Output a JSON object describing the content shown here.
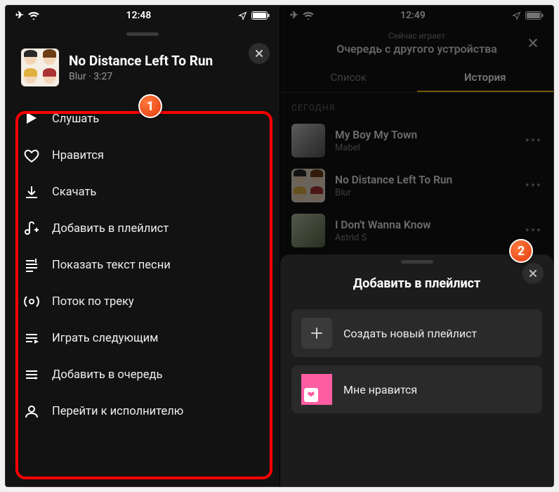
{
  "left": {
    "status": {
      "time": "12:48"
    },
    "track": {
      "title": "No Distance Left To Run",
      "artist": "Blur",
      "duration": "3:27"
    },
    "menu": [
      {
        "id": "listen",
        "label": "Слушать",
        "icon": "play-icon"
      },
      {
        "id": "like",
        "label": "Нравится",
        "icon": "heart-icon"
      },
      {
        "id": "download",
        "label": "Скачать",
        "icon": "download-icon"
      },
      {
        "id": "add-playlist",
        "label": "Добавить в плейлист",
        "icon": "add-playlist-icon"
      },
      {
        "id": "lyrics",
        "label": "Показать текст песни",
        "icon": "lyrics-icon"
      },
      {
        "id": "radio",
        "label": "Поток по треку",
        "icon": "radio-icon"
      },
      {
        "id": "play-next",
        "label": "Играть следующим",
        "icon": "play-next-icon"
      },
      {
        "id": "queue",
        "label": "Добавить в очередь",
        "icon": "queue-icon"
      },
      {
        "id": "artist",
        "label": "Перейти к исполнителю",
        "icon": "artist-icon"
      }
    ]
  },
  "right": {
    "status": {
      "time": "12:49"
    },
    "header": {
      "sub": "Сейчас играет",
      "main": "Очередь с другого устройства"
    },
    "tabs": {
      "list": "Список",
      "history": "История",
      "active": "history"
    },
    "section": "СЕГОДНЯ",
    "history": [
      {
        "title": "My Boy My Town",
        "artist": "Mabel"
      },
      {
        "title": "No Distance Left To Run",
        "artist": "Blur"
      },
      {
        "title": "I Don't Wanna Know",
        "artist": "Astrid S"
      }
    ],
    "sheet": {
      "title": "Добавить в плейлист",
      "items": [
        {
          "id": "create",
          "label": "Создать новый плейлист",
          "icon": "plus-icon"
        },
        {
          "id": "liked",
          "label": "Мне нравится",
          "icon": "heart-cover"
        }
      ]
    }
  },
  "markers": {
    "m1": "1",
    "m2": "2"
  }
}
